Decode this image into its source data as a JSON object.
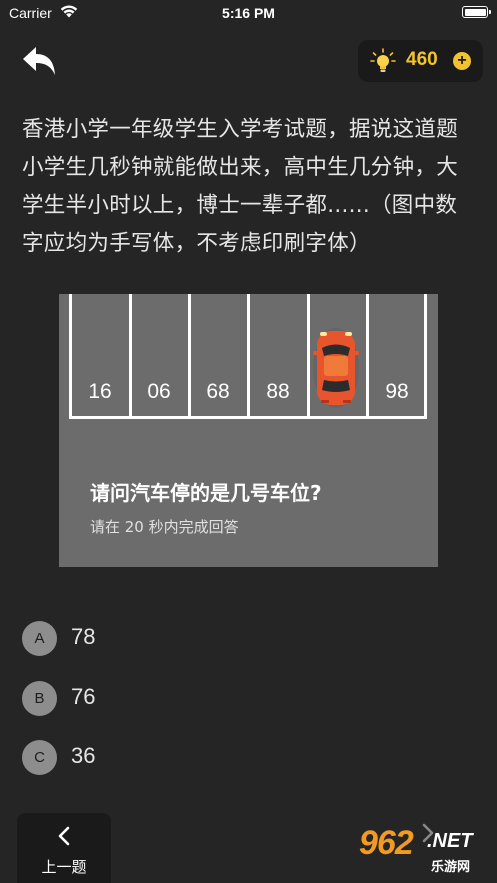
{
  "status_bar": {
    "carrier": "Carrier",
    "time": "5:16 PM"
  },
  "header": {
    "score": "460"
  },
  "question": {
    "text": "香港小学一年级学生入学考试题，据说这道题小学生几秒钟就能做出来，高中生几分钟，大学生半小时以上，博士一辈子都......（图中数字应均为手写体，不考虑印刷字体）"
  },
  "puzzle": {
    "slots": [
      "16",
      "06",
      "68",
      "88",
      "",
      "98"
    ],
    "question": "请问汽车停的是几号车位?",
    "hint": "请在 20 秒内完成回答"
  },
  "options": [
    {
      "letter": "A",
      "value": "78"
    },
    {
      "letter": "B",
      "value": "76"
    },
    {
      "letter": "C",
      "value": "36"
    }
  ],
  "footer": {
    "prev_label": "上一题"
  },
  "watermark": {
    "num": "962",
    "net": ".NET",
    "sub": "乐游网"
  },
  "colors": {
    "background": "#252525",
    "accent": "#f2c230",
    "puzzle_bg": "#6c6c6c",
    "car": "#e8542c"
  }
}
